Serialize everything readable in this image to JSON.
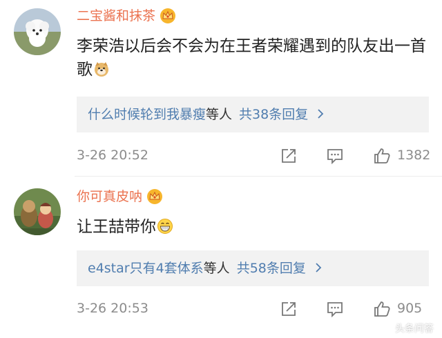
{
  "comments": [
    {
      "username": "二宝酱和抹茶",
      "text": "李荣浩以后会不会为在王者荣耀遇到的队友出一首歌",
      "replies": {
        "user": "什么时候轮到我暴瘦",
        "middle": "等人",
        "count": "共38条回复"
      },
      "timestamp": "3-26 20:52",
      "likes": "1382"
    },
    {
      "username": "你可真皮呐",
      "text": "让王喆带你",
      "replies": {
        "user": "e4star只有4套体系",
        "middle": "等人",
        "count": "共58条回复"
      },
      "timestamp": "3-26 20:53",
      "likes": "905"
    }
  ],
  "icons": {
    "crown": "crown-icon",
    "emoji_1": "doge-emoji-icon",
    "emoji_2": "grin-emoji-icon",
    "share": "share-icon",
    "comment": "comment-icon",
    "like": "thumbs-up-icon",
    "chevron": "chevron-right-icon"
  },
  "watermark": "头条问答",
  "colors": {
    "username": "#eb7350",
    "reply_link": "#507daf",
    "meta": "#8c8c8c",
    "reply_bg": "#f2f2f2"
  }
}
